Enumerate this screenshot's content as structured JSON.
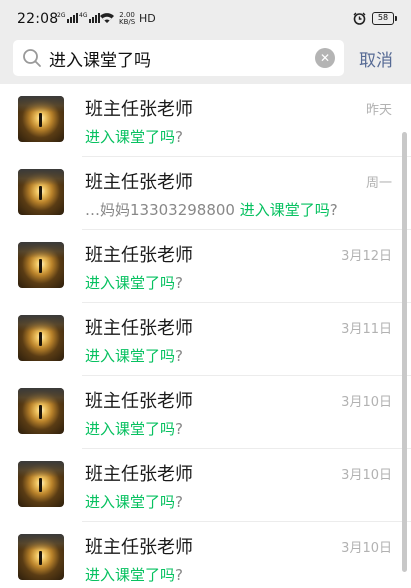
{
  "status_bar": {
    "time": "22:08",
    "network1": "2G",
    "network2": "4G",
    "speed_value": "2.00",
    "speed_unit": "KB/S",
    "hd": "HD",
    "battery": "58"
  },
  "search": {
    "query": "进入课堂了吗",
    "cancel_label": "取消"
  },
  "results": [
    {
      "name": "班主任张老师",
      "date": "昨天",
      "prefix": "",
      "match": "进入课堂了吗",
      "suffix": "?"
    },
    {
      "name": "班主任张老师",
      "date": "周一",
      "prefix": "…妈妈13303298800 ",
      "match": "进入课堂了吗",
      "suffix": "?"
    },
    {
      "name": "班主任张老师",
      "date": "3月12日",
      "prefix": "",
      "match": "进入课堂了吗",
      "suffix": "?"
    },
    {
      "name": "班主任张老师",
      "date": "3月11日",
      "prefix": "",
      "match": "进入课堂了吗",
      "suffix": "?"
    },
    {
      "name": "班主任张老师",
      "date": "3月10日",
      "prefix": "",
      "match": "进入课堂了吗",
      "suffix": "?"
    },
    {
      "name": "班主任张老师",
      "date": "3月10日",
      "prefix": "",
      "match": "进入课堂了吗",
      "suffix": "?"
    },
    {
      "name": "班主任张老师",
      "date": "3月10日",
      "prefix": "",
      "match": "进入课堂了吗",
      "suffix": "?"
    }
  ],
  "colors": {
    "highlight": "#07c160",
    "cancel": "#576b95",
    "background": "#ededed"
  },
  "icons": [
    "signal-icon",
    "wifi-icon",
    "alarm-icon",
    "battery-icon",
    "search-icon",
    "clear-icon",
    "avatar"
  ]
}
